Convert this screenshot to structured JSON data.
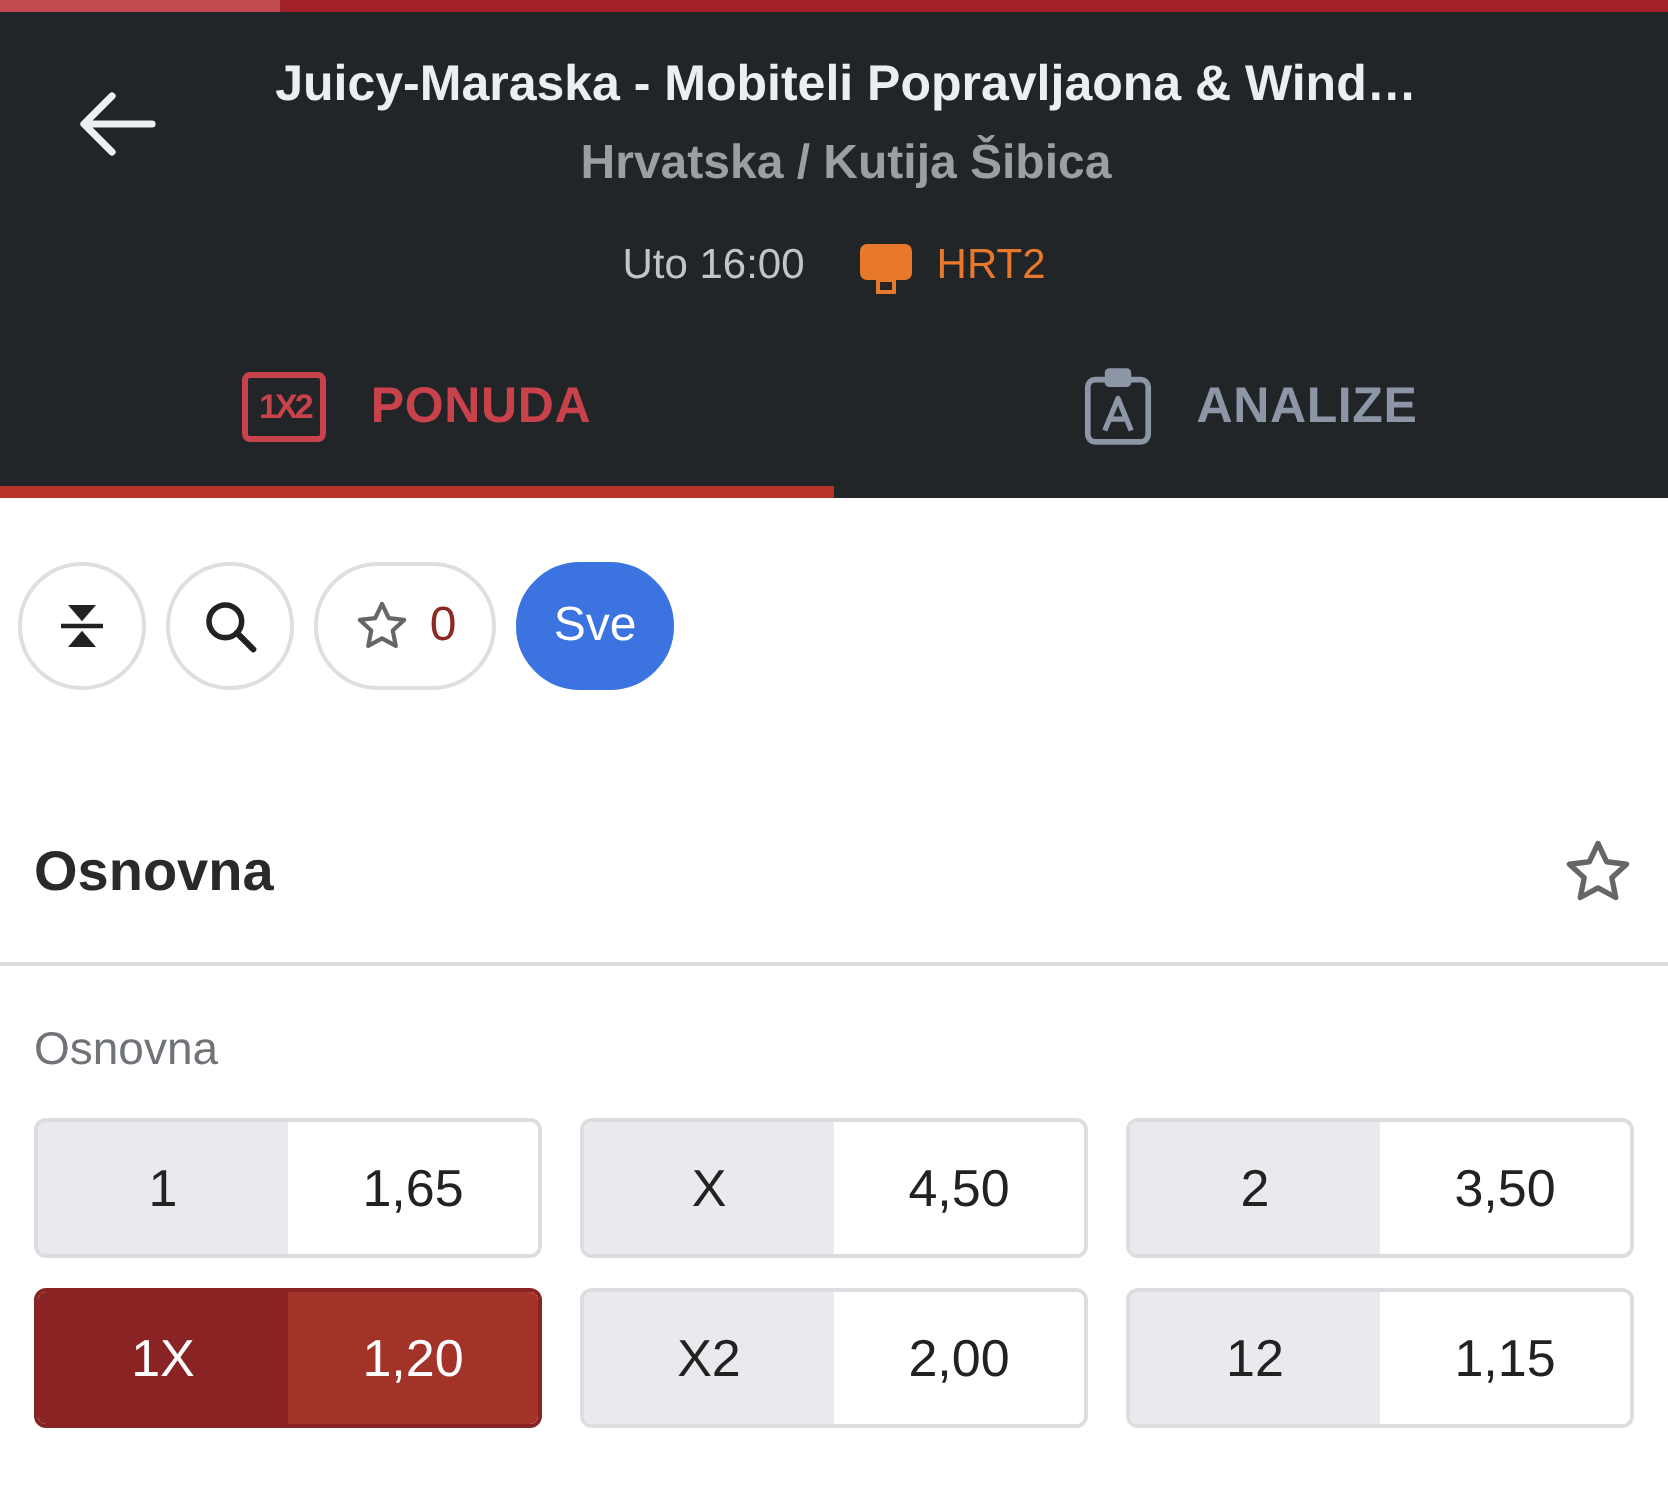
{
  "header": {
    "title": "Juicy-Maraska - Mobiteli Popravljaona & Wind…",
    "subtitle": "Hrvatska / Kutija Šibica",
    "time": "Uto 16:00",
    "channel": "HRT2"
  },
  "tabs": [
    {
      "label": "PONUDA",
      "badge": "1X2",
      "selected": true
    },
    {
      "label": "ANALIZE",
      "selected": false
    }
  ],
  "toolbar": [
    {
      "kind": "collapse"
    },
    {
      "kind": "search"
    },
    {
      "kind": "favorites",
      "count": "0"
    },
    {
      "kind": "filter",
      "label": "Sve",
      "selected": true
    }
  ],
  "market": {
    "title": "Osnovna",
    "favorite": false
  },
  "group": {
    "title": "Osnovna",
    "outcomes": [
      {
        "label": "1",
        "odds": "1,65",
        "selected": false
      },
      {
        "label": "X",
        "odds": "4,50",
        "selected": false
      },
      {
        "label": "2",
        "odds": "3,50",
        "selected": false
      },
      {
        "label": "1X",
        "odds": "1,20",
        "selected": true
      },
      {
        "label": "X2",
        "odds": "2,00",
        "selected": false
      },
      {
        "label": "12",
        "odds": "1,15",
        "selected": false
      }
    ]
  }
}
